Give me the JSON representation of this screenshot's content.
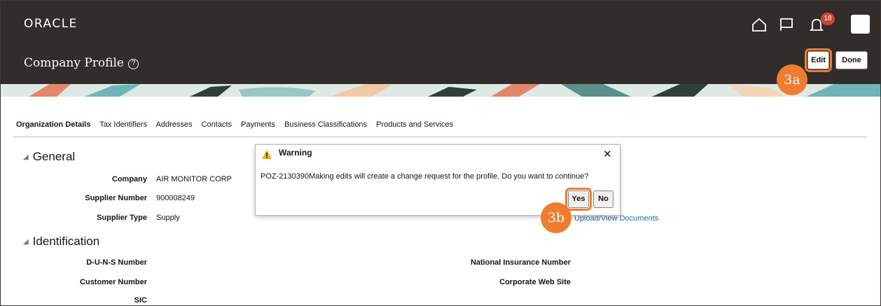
{
  "app": {
    "brand": "ORACLE"
  },
  "header": {
    "notifications_count": "18",
    "icons": [
      "home-icon",
      "flag-icon",
      "bell-icon",
      "user-avatar"
    ]
  },
  "page": {
    "title": "Company Profile",
    "help_symbol": "?",
    "edit_label": "Edit",
    "done_label": "Done"
  },
  "tabs": [
    {
      "label": "Organization Details",
      "active": true
    },
    {
      "label": "Tax Identifiers",
      "active": false
    },
    {
      "label": "Addresses",
      "active": false
    },
    {
      "label": "Contacts",
      "active": false
    },
    {
      "label": "Payments",
      "active": false
    },
    {
      "label": "Business Classifications",
      "active": false
    },
    {
      "label": "Products and Services",
      "active": false
    }
  ],
  "general": {
    "heading": "General",
    "company_label": "Company",
    "company_value": "AIR MONITOR CORP",
    "supplier_number_label": "Supplier Number",
    "supplier_number_value": "900008249",
    "supplier_type_label": "Supplier Type",
    "supplier_type_value": "Supply",
    "upload_link": "Upload/View Documents"
  },
  "identification": {
    "heading": "Identification",
    "duns_label": "D-U-N-S Number",
    "customer_number_label": "Customer Number",
    "sic_label": "SIC",
    "national_insurance_label": "National Insurance Number",
    "corporate_web_site_label": "Corporate Web Site"
  },
  "dialog": {
    "title": "Warning",
    "close_symbol": "✕",
    "message": "POZ-2130390Making edits will create a change request for the profile. Do you want to continue?",
    "yes_label": "Yes",
    "no_label": "No"
  },
  "callouts": {
    "edit_step": "3a",
    "yes_step": "3b"
  },
  "colors": {
    "header_bg": "#312d2a",
    "callout": "#ef7c30",
    "badge": "#c74634",
    "link": "#2a6f97"
  }
}
